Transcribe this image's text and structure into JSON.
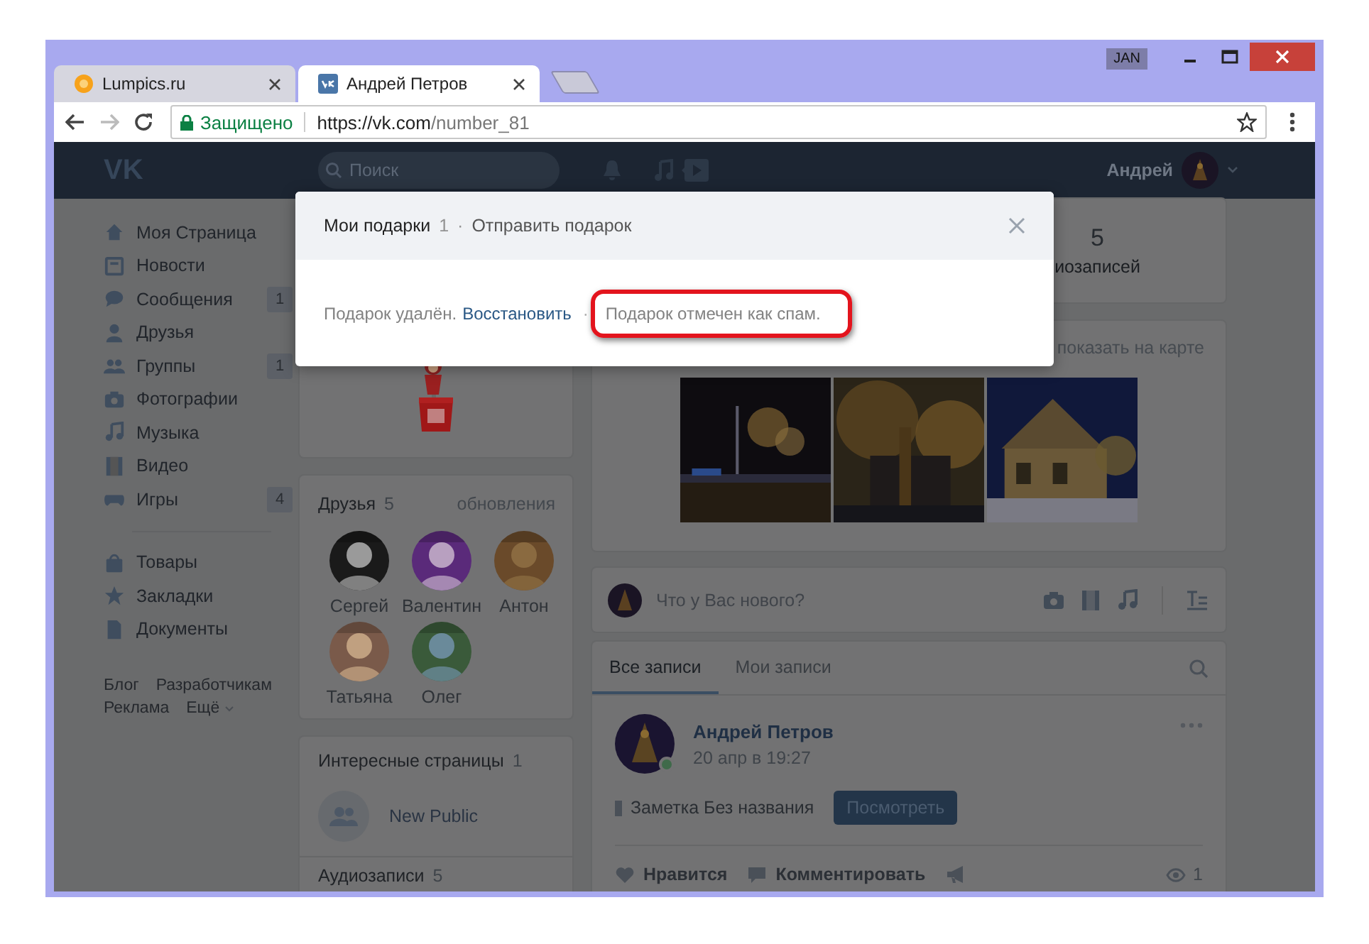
{
  "browser": {
    "tabs": [
      {
        "title": "Lumpics.ru",
        "selected": false
      },
      {
        "title": "Андрей Петров",
        "selected": true
      }
    ],
    "profile_badge": "JAN",
    "address": {
      "security": "Защищено",
      "url_host": "https://vk.com",
      "url_path": "/number_81"
    }
  },
  "header": {
    "logo": "VK",
    "search_placeholder": "Поиск",
    "user": "Андрей"
  },
  "sidebar": {
    "sections": [
      {
        "items": [
          {
            "label": "Моя Страница"
          },
          {
            "label": "Новости"
          },
          {
            "label": "Сообщения",
            "count": "1"
          },
          {
            "label": "Друзья"
          },
          {
            "label": "Группы",
            "count": "1"
          },
          {
            "label": "Фотографии"
          },
          {
            "label": "Музыка"
          },
          {
            "label": "Видео"
          },
          {
            "label": "Игры",
            "count": "4"
          }
        ]
      },
      {
        "items": [
          {
            "label": "Товары"
          },
          {
            "label": "Закладки"
          },
          {
            "label": "Документы"
          }
        ]
      }
    ],
    "links": [
      "Блог",
      "Разработчикам",
      "Реклама",
      "Ещё"
    ]
  },
  "friends": {
    "title": "Друзья",
    "count": "5",
    "link": "обновления",
    "people": [
      {
        "name": "Сергей"
      },
      {
        "name": "Валентин"
      },
      {
        "name": "Антон"
      },
      {
        "name": "Татьяна"
      },
      {
        "name": "Олег"
      }
    ]
  },
  "pages": {
    "title": "Интересные страницы",
    "count": "1",
    "items": [
      {
        "name": "New Public"
      }
    ]
  },
  "audio": {
    "title": "Аудиозаписи",
    "count": "5"
  },
  "stats": {
    "value": "5",
    "label": "иозаписей"
  },
  "photos": {
    "link": "показать на карте"
  },
  "composer": {
    "placeholder": "Что у Вас нового?"
  },
  "wall": {
    "tabs": [
      {
        "label": "Все записи",
        "selected": true
      },
      {
        "label": "Мои записи",
        "selected": false
      }
    ],
    "post": {
      "author": "Андрей Петров",
      "time": "20 апр в 19:27",
      "online": true,
      "note": "Заметка Без названия",
      "button": "Посмотреть",
      "actions": [
        "Нравится",
        "Комментировать"
      ],
      "views": "1"
    }
  },
  "modal": {
    "title": "Мои подарки",
    "count": "1",
    "title_separator": "·",
    "link": "Отправить подарок",
    "message": "Подарок удалён.",
    "restore": "Восстановить",
    "separator": "·",
    "spam_note": "Подарок отмечен как спам.",
    "highlighted": true
  }
}
